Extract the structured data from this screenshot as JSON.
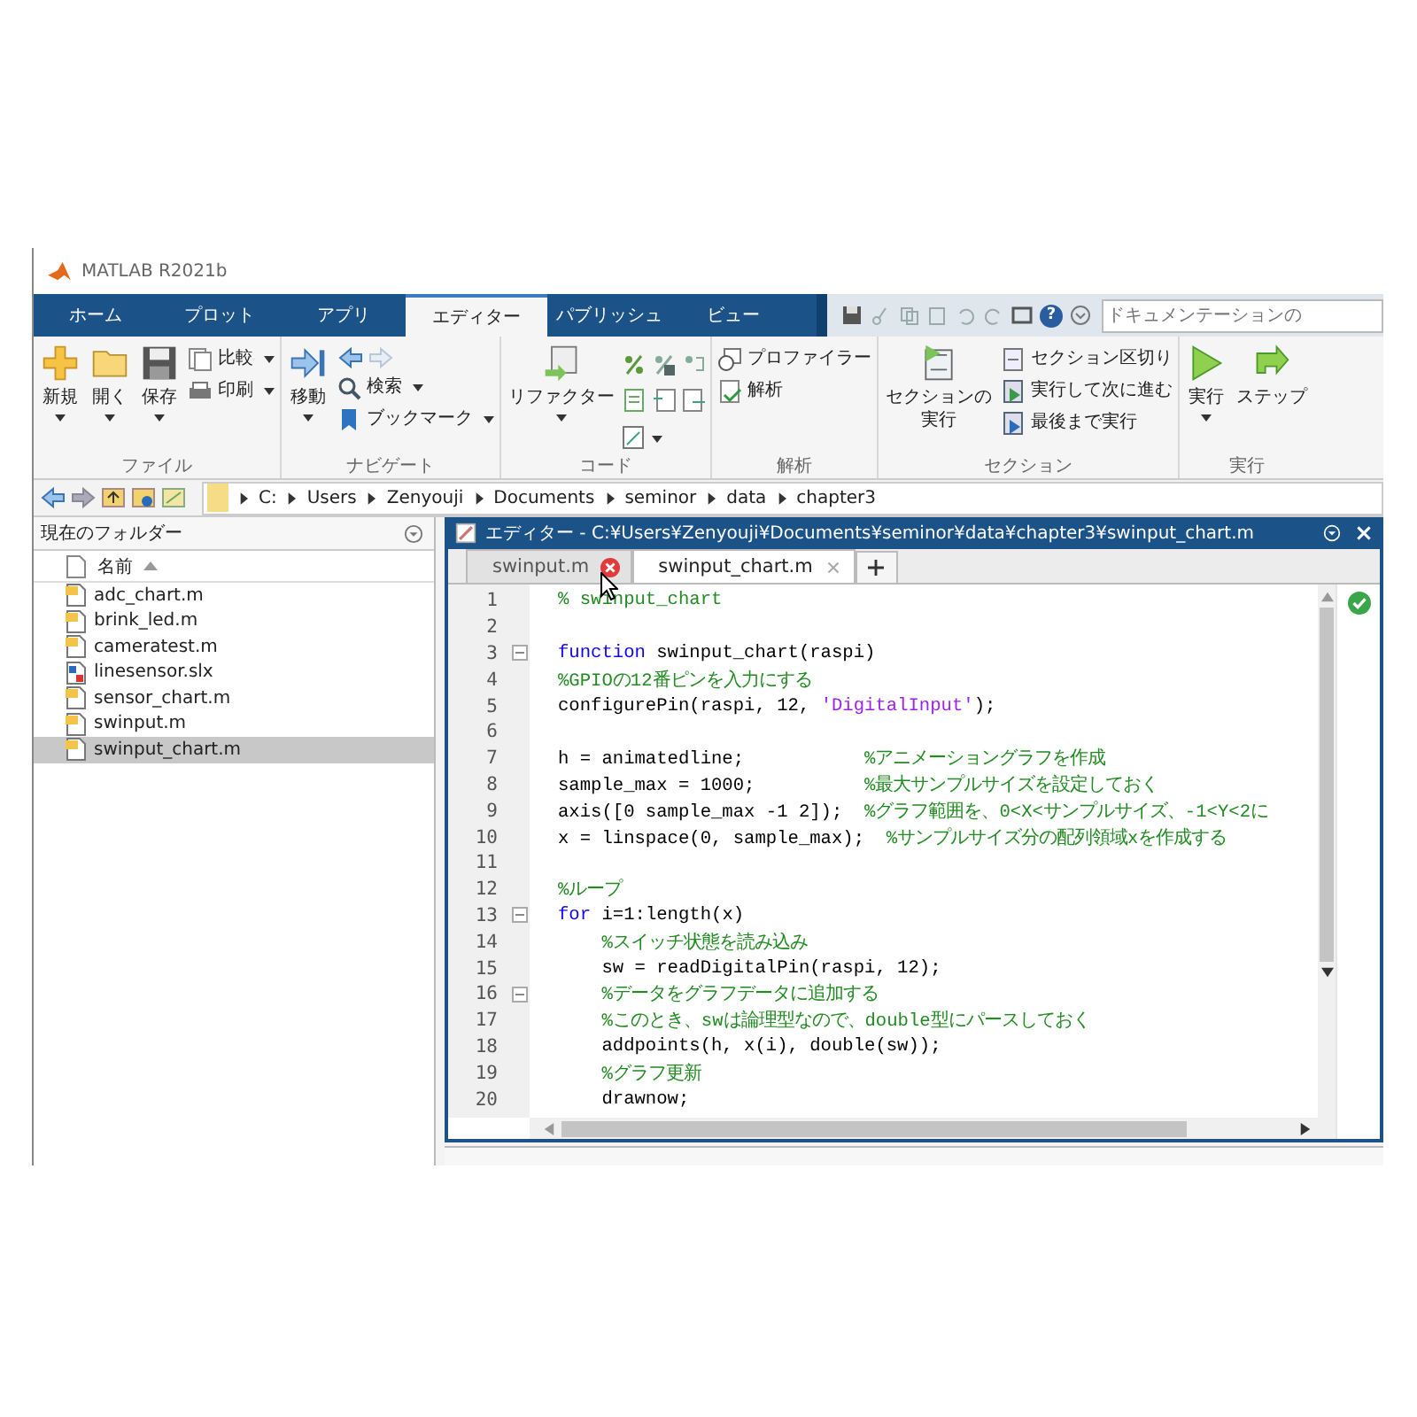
{
  "window": {
    "title": "MATLAB R2021b"
  },
  "ribbon_tabs": [
    {
      "label": "ホーム",
      "selected": false
    },
    {
      "label": "プロット",
      "selected": false
    },
    {
      "label": "アプリ",
      "selected": false
    },
    {
      "label": "エディター",
      "selected": true
    },
    {
      "label": "パブリッシュ",
      "selected": false
    },
    {
      "label": "ビュー",
      "selected": false
    }
  ],
  "quick_access": {
    "help": "?",
    "search_placeholder": "ドキュメンテーションの"
  },
  "ribbon": {
    "file": {
      "label": "ファイル",
      "new": "新規",
      "open": "開く",
      "save": "保存",
      "compare": "比較",
      "print": "印刷"
    },
    "navigate": {
      "label": "ナビゲート",
      "go": "移動",
      "find": "検索",
      "bookmark": "ブックマーク"
    },
    "code": {
      "label": "コード",
      "refactor": "リファクター"
    },
    "analyze": {
      "label": "解析",
      "profiler": "プロファイラー",
      "analyze": "解析"
    },
    "section": {
      "label": "セクション",
      "run_section": [
        "セクションの",
        "実行"
      ],
      "section_break": "セクション区切り",
      "run_advance": "実行して次に進む",
      "run_to_end": "最後まで実行"
    },
    "run": {
      "label": "実行",
      "run": "実行",
      "step": "ステップ"
    }
  },
  "path": [
    "C:",
    "Users",
    "Zenyouji",
    "Documents",
    "seminor",
    "data",
    "chapter3"
  ],
  "folder_panel": {
    "title": "現在のフォルダー",
    "column": "名前",
    "files": [
      {
        "name": "adc_chart.m",
        "kind": "m",
        "selected": false
      },
      {
        "name": "brink_led.m",
        "kind": "m",
        "selected": false
      },
      {
        "name": "cameratest.m",
        "kind": "m",
        "selected": false
      },
      {
        "name": "linesensor.slx",
        "kind": "slx",
        "selected": false
      },
      {
        "name": "sensor_chart.m",
        "kind": "m",
        "selected": false
      },
      {
        "name": "swinput.m",
        "kind": "m",
        "selected": false
      },
      {
        "name": "swinput_chart.m",
        "kind": "m",
        "selected": true
      }
    ]
  },
  "editor": {
    "title": "エディター - C:¥Users¥Zenyouji¥Documents¥seminor¥data¥chapter3¥swinput_chart.m",
    "tabs": [
      {
        "label": "swinput.m",
        "selected": false,
        "close_hover": true
      },
      {
        "label": "swinput_chart.m",
        "selected": true,
        "close_hover": false
      }
    ],
    "lines": [
      {
        "no": "1",
        "fold": false,
        "parts": [
          {
            "t": "% swinput_chart",
            "kind": "comment"
          }
        ]
      },
      {
        "no": "2",
        "fold": false
      },
      {
        "no": "3",
        "fold": true,
        "parts": [
          {
            "t": "function",
            "kind": "keyword"
          },
          {
            "t": " swinput_chart(raspi)",
            "kind": "code"
          }
        ]
      },
      {
        "no": "4",
        "fold": false,
        "parts": [
          {
            "t": "%GPIOの12番ピンを入力にする",
            "kind": "comment"
          }
        ]
      },
      {
        "no": "5",
        "fold": false,
        "parts": [
          {
            "t": "configurePin(raspi, 12, ",
            "kind": "code"
          },
          {
            "t": "'DigitalInput'",
            "kind": "string"
          },
          {
            "t": ");",
            "kind": "code"
          }
        ]
      },
      {
        "no": "6",
        "fold": false
      },
      {
        "no": "7",
        "fold": false,
        "parts": [
          {
            "t": "h = animatedline;           ",
            "kind": "code"
          },
          {
            "t": "%アニメーショングラフを作成",
            "kind": "comment"
          }
        ]
      },
      {
        "no": "8",
        "fold": false,
        "parts": [
          {
            "t": "sample_max = 1000;          ",
            "kind": "code"
          },
          {
            "t": "%最大サンプルサイズを設定しておく",
            "kind": "comment"
          }
        ]
      },
      {
        "no": "9",
        "fold": false,
        "parts": [
          {
            "t": "axis([0 sample_max -1 2]);  ",
            "kind": "code"
          },
          {
            "t": "%グラフ範囲を、0<X<サンプルサイズ、-1<Y<2に",
            "kind": "comment"
          }
        ]
      },
      {
        "no": "10",
        "fold": false,
        "parts": [
          {
            "t": "x = linspace(0, sample_max);  ",
            "kind": "code"
          },
          {
            "t": "%サンプルサイズ分の配列領域xを作成する",
            "kind": "comment"
          }
        ]
      },
      {
        "no": "11",
        "fold": false
      },
      {
        "no": "12",
        "fold": false,
        "parts": [
          {
            "t": "%ループ",
            "kind": "comment"
          }
        ]
      },
      {
        "no": "13",
        "fold": true,
        "parts": [
          {
            "t": "for",
            "kind": "keyword"
          },
          {
            "t": " i=1:length(x)",
            "kind": "code"
          }
        ]
      },
      {
        "no": "14",
        "fold": false,
        "parts": [
          {
            "t": "    %スイッチ状態を読み込み",
            "kind": "comment"
          }
        ]
      },
      {
        "no": "15",
        "fold": false,
        "parts": [
          {
            "t": "    sw = readDigitalPin(raspi, 12);",
            "kind": "code"
          }
        ]
      },
      {
        "no": "16",
        "fold": true,
        "parts": [
          {
            "t": "    %データをグラフデータに追加する",
            "kind": "comment"
          }
        ]
      },
      {
        "no": "17",
        "fold": false,
        "parts": [
          {
            "t": "    %このとき、swは論理型なので、double型にパースしておく",
            "kind": "comment"
          }
        ]
      },
      {
        "no": "18",
        "fold": false,
        "parts": [
          {
            "t": "    addpoints(h, x(i), double(sw));",
            "kind": "code"
          }
        ]
      },
      {
        "no": "19",
        "fold": false,
        "parts": [
          {
            "t": "    %グラフ更新",
            "kind": "comment"
          }
        ]
      },
      {
        "no": "20",
        "fold": false,
        "parts": [
          {
            "t": "    drawnow;",
            "kind": "code"
          }
        ]
      }
    ]
  }
}
